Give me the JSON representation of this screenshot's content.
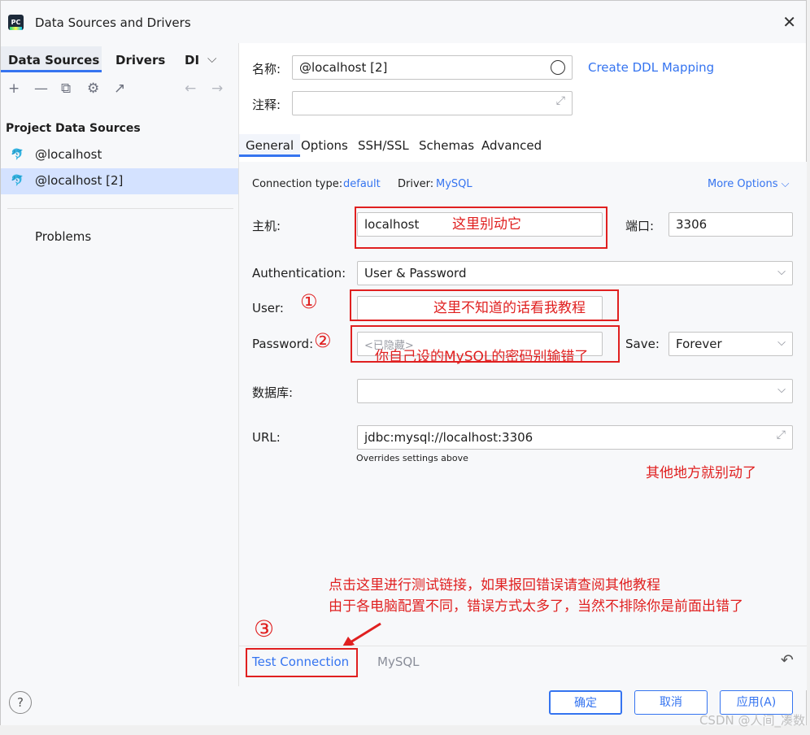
{
  "window": {
    "title": "Data Sources and Drivers",
    "app_icon_text": "PC"
  },
  "left": {
    "tabs": [
      "Data Sources",
      "Drivers",
      "DI"
    ],
    "section_title": "Project Data Sources",
    "items": [
      "@localhost",
      "@localhost [2]"
    ],
    "problems": "Problems"
  },
  "form": {
    "name_label": "名称:",
    "name_value": "@localhost [2]",
    "ddl_link": "Create DDL Mapping",
    "comment_label": "注释:",
    "tabs": [
      "General",
      "Options",
      "SSH/SSL",
      "Schemas",
      "Advanced"
    ],
    "conn_type_label": "Connection type:",
    "conn_type_value": "default",
    "driver_label": "Driver:",
    "driver_value": "MySQL",
    "more_options": "More Options",
    "host_label": "主机:",
    "host_value": "localhost",
    "port_label": "端口:",
    "port_value": "3306",
    "auth_label": "Authentication:",
    "auth_value": "User & Password",
    "user_label": "User:",
    "password_label": "Password:",
    "password_placeholder": "<已隐藏>",
    "save_label": "Save:",
    "save_value": "Forever",
    "db_label": "数据库:",
    "url_label": "URL:",
    "url_value": "jdbc:mysql://localhost:3306",
    "overrides_note": "Overrides settings above"
  },
  "bottom": {
    "test_connection": "Test Connection",
    "driver_name": "MySQL"
  },
  "footer": {
    "ok": "确定",
    "cancel": "取消",
    "apply": "应用(A)",
    "help": "?"
  },
  "annotations": {
    "host_note": "这里别动它",
    "user_note": "这里不知道的话看我教程",
    "password_note": "你自己设的MySQL的密码别输错了",
    "other_note": "其他地方就别动了",
    "test_note_line1": "点击这里进行测试链接，如果报回错误请查阅其他教程",
    "test_note_line2": "由于各电脑配置不同，错误方式太多了，当然不排除你是前面出错了"
  },
  "watermark": "CSDN @人间_凑数"
}
